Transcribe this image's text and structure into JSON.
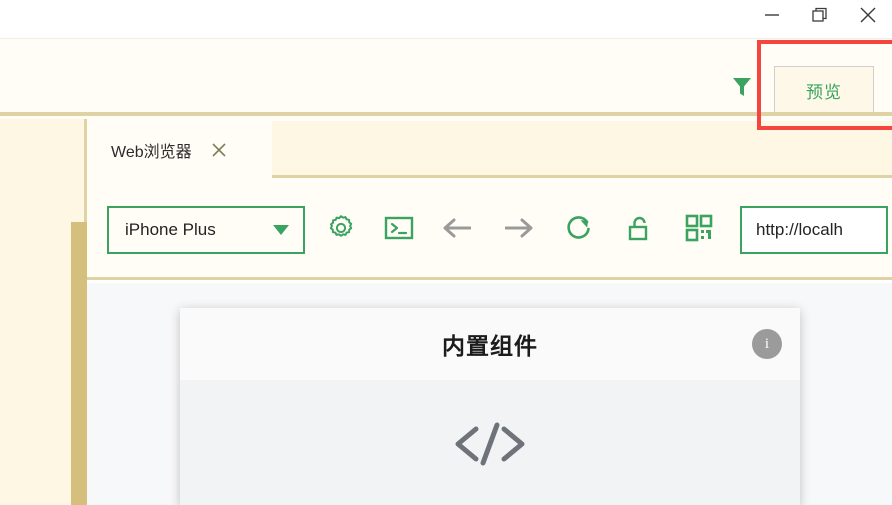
{
  "window": {
    "controls": [
      {
        "name": "minimize",
        "glyph": "minimize-icon"
      },
      {
        "name": "restore",
        "glyph": "restore-icon"
      },
      {
        "name": "close",
        "glyph": "close-icon"
      }
    ]
  },
  "subtoolbar": {
    "filter_icon": "funnel-icon",
    "preview_label": "预览",
    "highlight_color": "#f6453f"
  },
  "tabs": [
    {
      "label": "Web浏览器",
      "active": true,
      "close_glyph": "close-icon"
    }
  ],
  "browser_toolbar": {
    "device": {
      "value": "iPhone Plus",
      "caret": "chevron-down-icon"
    },
    "icons": [
      {
        "name": "settings-icon",
        "color": "#3aa35f"
      },
      {
        "name": "console-icon",
        "color": "#3aa35f"
      },
      {
        "name": "back-icon",
        "color": "#9a9a9a"
      },
      {
        "name": "forward-icon",
        "color": "#9a9a9a"
      },
      {
        "name": "refresh-icon",
        "color": "#3aa35f"
      },
      {
        "name": "unlock-icon",
        "color": "#3aa35f"
      },
      {
        "name": "qrcode-icon",
        "color": "#3aa35f"
      }
    ],
    "url": {
      "value": "http://localh",
      "placeholder": "http://"
    }
  },
  "preview_canvas": {
    "card": {
      "title": "内置组件",
      "info_label": "i",
      "content_icon": "code-icon"
    }
  },
  "colors": {
    "accent_green": "#3aa35f",
    "cream": "#fffdf6",
    "beige": "#fdf7e4",
    "tan": "#dfd3a5",
    "scrollbar": "#d4bf7c",
    "highlight_red": "#f6453f"
  }
}
